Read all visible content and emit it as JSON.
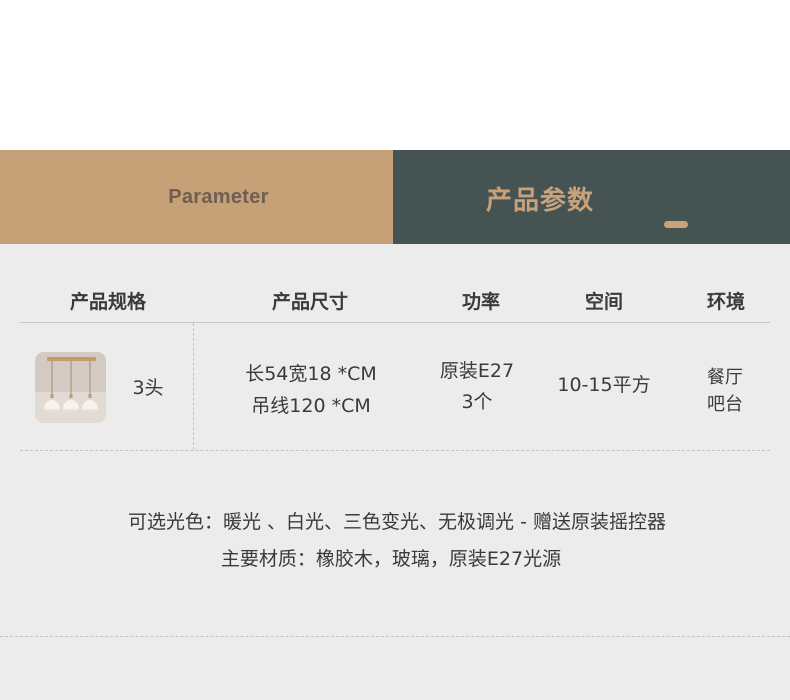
{
  "banner": {
    "left_text": "Parameter",
    "right_text": "产品参数",
    "left_color": "#c6a077",
    "right_color": "#455352",
    "accent_color": "#c9a27a"
  },
  "table": {
    "headers": [
      "产品规格",
      "产品尺寸",
      "功率",
      "空间",
      "环境"
    ],
    "row": {
      "thumbnail_icon": "pendant-lamp-3-heads",
      "heads": "3头",
      "size_lines": [
        "长54宽18 *CM",
        "吊线120 *CM"
      ],
      "power_lines": [
        "原装E27",
        "3个"
      ],
      "space": "10-15平方",
      "env_lines": [
        "餐厅",
        "吧台"
      ]
    }
  },
  "notes": {
    "colors": "可选光色：暖光 、白光、三色变光、无极调光 - 赠送原装摇控器",
    "material": "主要材质：橡胶木，玻璃，原装E27光源"
  }
}
